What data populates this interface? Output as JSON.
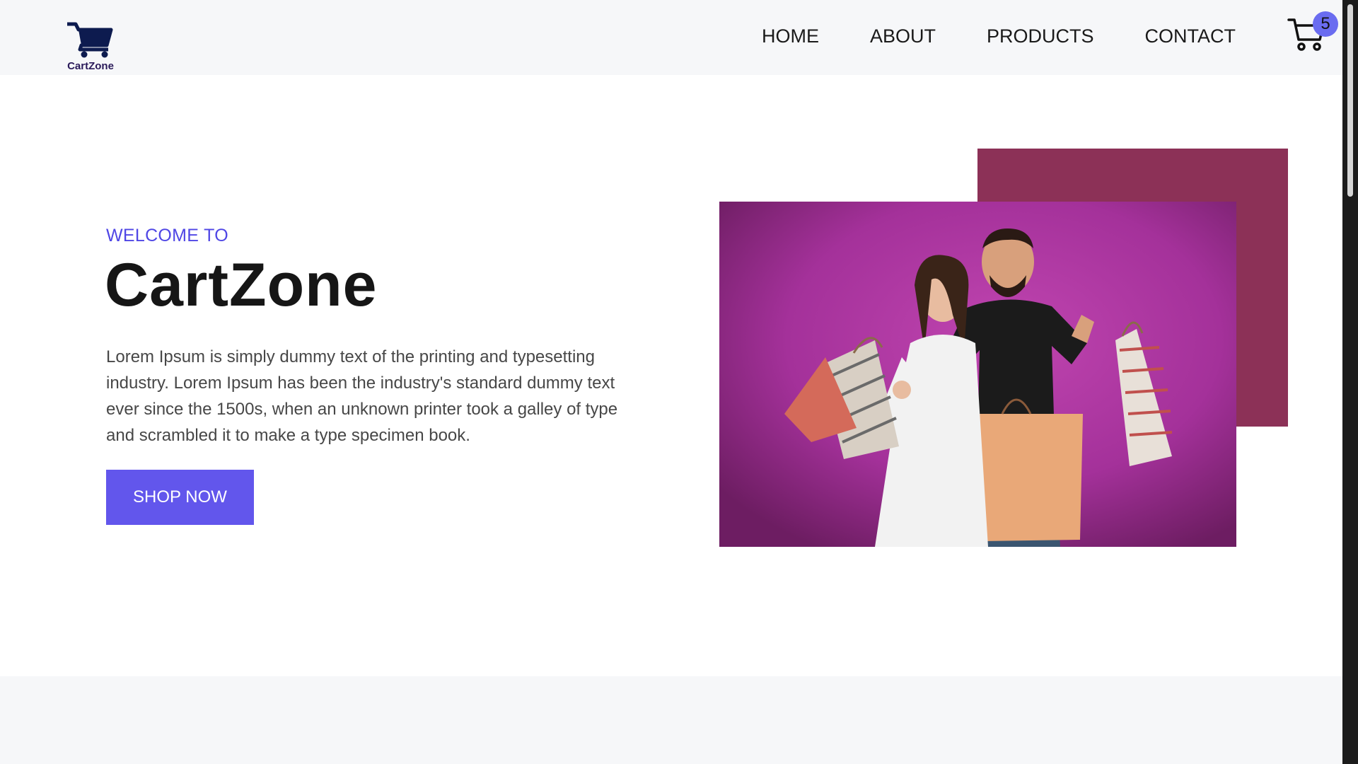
{
  "header": {
    "logo_text": "CartZone",
    "nav": [
      "HOME",
      "ABOUT",
      "PRODUCTS",
      "CONTACT"
    ],
    "cart_count": "5",
    "cart_icon": "shopping-cart-icon",
    "logo_icon": "shopping-cart-icon"
  },
  "hero": {
    "welcome": "WELCOME TO",
    "title": "CartZone",
    "description": "Lorem Ipsum is simply dummy text of the printing and typesetting industry. Lorem Ipsum has been the industry's standard dummy text ever since the 1500s, when an unknown printer took a galley of type and scrambled it to make a type specimen book.",
    "button_label": "SHOP NOW",
    "image_alt": "Couple holding shopping bags"
  },
  "colors": {
    "accent": "#4f46e5",
    "button": "#6256ec",
    "accent_block": "#8c3157",
    "image_background": "#a4319a",
    "badge": "#6a6cf0",
    "logo": "#0d1b4f"
  }
}
